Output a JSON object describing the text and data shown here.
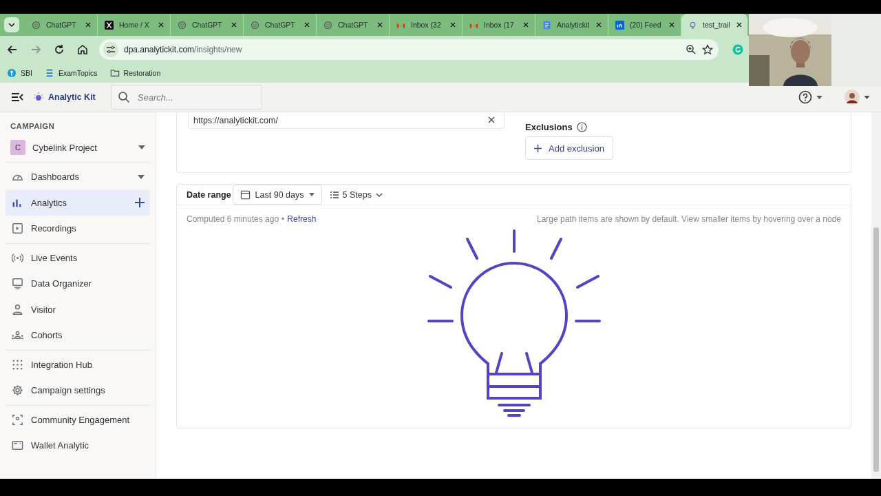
{
  "browser": {
    "tabs": [
      {
        "kind": "openai",
        "label": "ChatGPT",
        "selected": false
      },
      {
        "kind": "x",
        "label": "Home / X",
        "selected": false
      },
      {
        "kind": "openai",
        "label": "ChatGPT",
        "selected": false
      },
      {
        "kind": "openai",
        "label": "ChatGPT",
        "selected": false
      },
      {
        "kind": "openai",
        "label": "ChatGPT",
        "selected": false
      },
      {
        "kind": "gmail",
        "label": "Inbox (32",
        "selected": false
      },
      {
        "kind": "gmail",
        "label": "Inbox (17",
        "selected": false
      },
      {
        "kind": "docs",
        "label": "Analytickit",
        "selected": false
      },
      {
        "kind": "linkedin",
        "label": "(20) Feed",
        "selected": false
      },
      {
        "kind": "bulb",
        "label": "test_trail",
        "selected": true
      }
    ],
    "address": {
      "domain": "dpa.analytickit.com",
      "path": "/insights/new"
    },
    "bookmarks": [
      {
        "kind": "sbi",
        "label": "SBI"
      },
      {
        "kind": "lines",
        "label": "ExamTopics"
      },
      {
        "kind": "folder",
        "label": "Restoration"
      }
    ]
  },
  "app": {
    "brand": "Analytic Kit",
    "search": {
      "placeholder": "Search..."
    }
  },
  "sidebar": {
    "heading": "CAMPAIGN",
    "project": {
      "initial": "C",
      "name": "Cybelink Project"
    },
    "sections": [
      {
        "items": [
          {
            "kind": "gauge",
            "label": "Dashboards",
            "selected": false,
            "dropdown": true
          },
          {
            "kind": "bars",
            "label": "Analytics",
            "selected": true,
            "add": true
          },
          {
            "kind": "play",
            "label": "Recordings",
            "selected": false
          }
        ]
      },
      {
        "items": [
          {
            "kind": "live",
            "label": "Live Events",
            "selected": false
          },
          {
            "kind": "monitor",
            "label": "Data Organizer",
            "selected": false
          },
          {
            "kind": "person",
            "label": "Visitor",
            "selected": false
          },
          {
            "kind": "group",
            "label": "Cohorts",
            "selected": false
          }
        ]
      },
      {
        "items": [
          {
            "kind": "grid",
            "label": "Integration Hub",
            "selected": false
          },
          {
            "kind": "gear",
            "label": "Campaign settings",
            "selected": false
          }
        ]
      },
      {
        "items": [
          {
            "kind": "focus",
            "label": "Community Engagement",
            "selected": false
          },
          {
            "kind": "window",
            "label": "Wallet Analytic",
            "selected": false
          }
        ]
      }
    ]
  },
  "filters": {
    "url_value": "https://analytickit.com/",
    "exclusions_label": "Exclusions",
    "add_exclusion": "Add exclusion"
  },
  "toolbar": {
    "date_label": "Date range",
    "date_value": "Last 90 days",
    "steps": "5 Steps"
  },
  "status": {
    "computed": "Computed 6 minutes ago",
    "separator": "•",
    "refresh": "Refresh",
    "hint": "Large path items are shown by default. View smaller items by hovering over a node"
  }
}
